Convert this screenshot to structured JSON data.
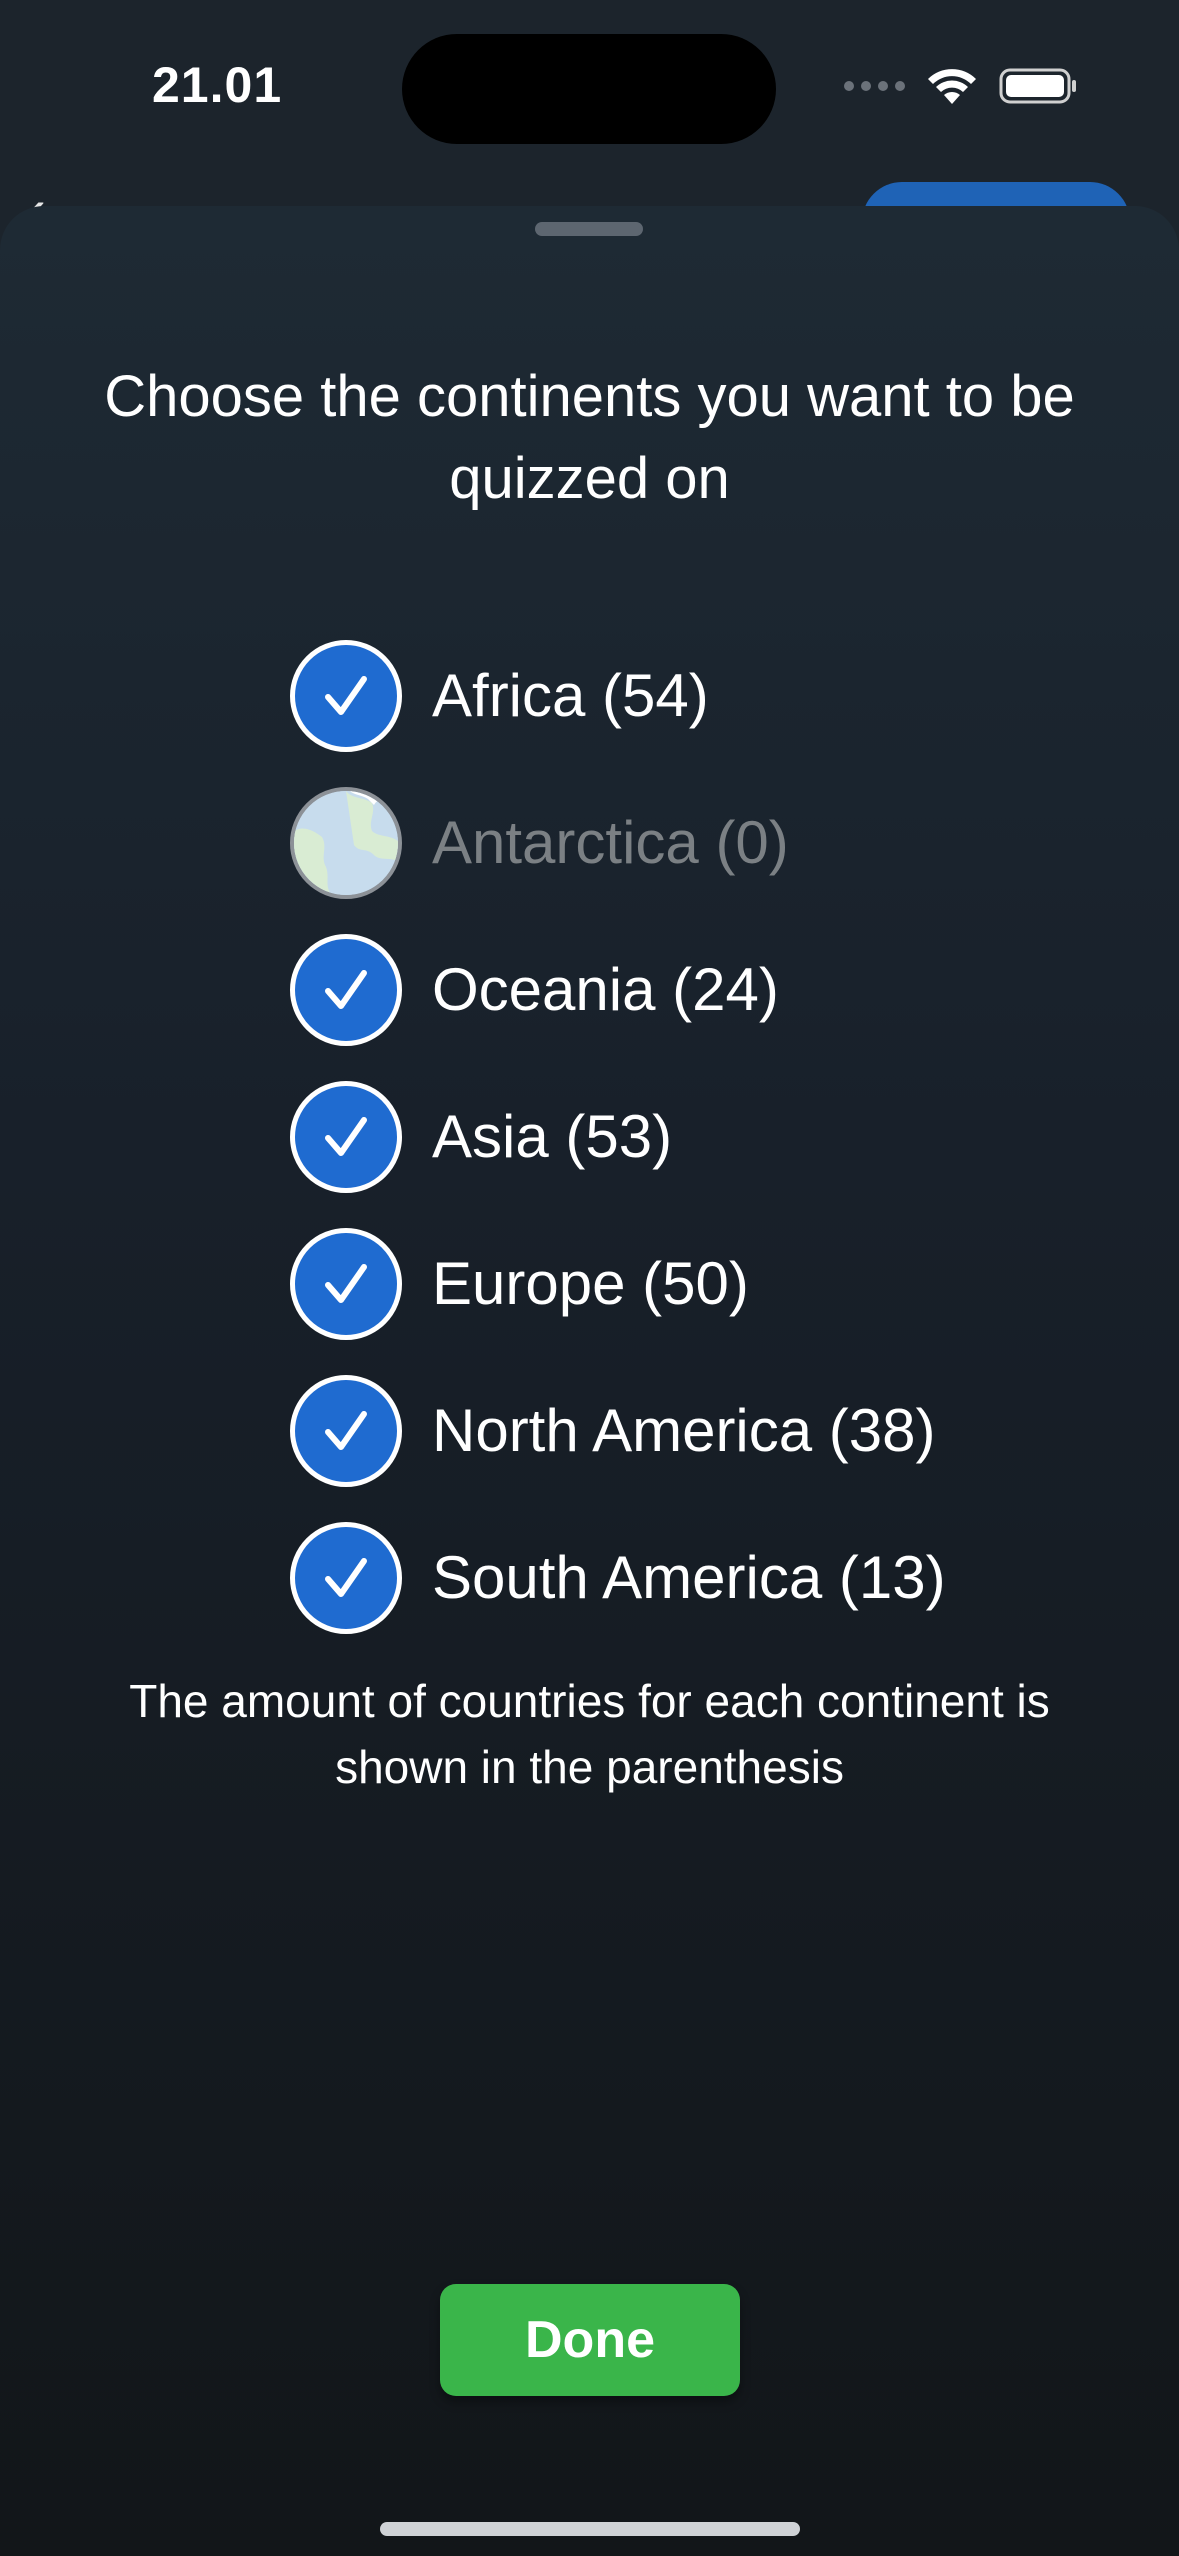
{
  "status_bar": {
    "time": "21.01"
  },
  "sheet": {
    "title": "Choose the continents you want to be quizzed on",
    "continents": [
      {
        "label": "Africa (54)",
        "selected": true,
        "enabled": true
      },
      {
        "label": "Antarctica (0)",
        "selected": false,
        "enabled": false
      },
      {
        "label": "Oceania (24)",
        "selected": true,
        "enabled": true
      },
      {
        "label": "Asia (53)",
        "selected": true,
        "enabled": true
      },
      {
        "label": "Europe (50)",
        "selected": true,
        "enabled": true
      },
      {
        "label": "North America (38)",
        "selected": true,
        "enabled": true
      },
      {
        "label": "South America (13)",
        "selected": true,
        "enabled": true
      }
    ],
    "note": "The amount of countries for each continent is shown in the parenthesis",
    "done_label": "Done"
  },
  "colors": {
    "accent_blue": "#1f6bd0",
    "done_green": "#3ab54a",
    "disabled_text": "#7b8084"
  },
  "icons": {
    "selected": "checkmark-circle-icon",
    "disabled": "globe-icon"
  }
}
